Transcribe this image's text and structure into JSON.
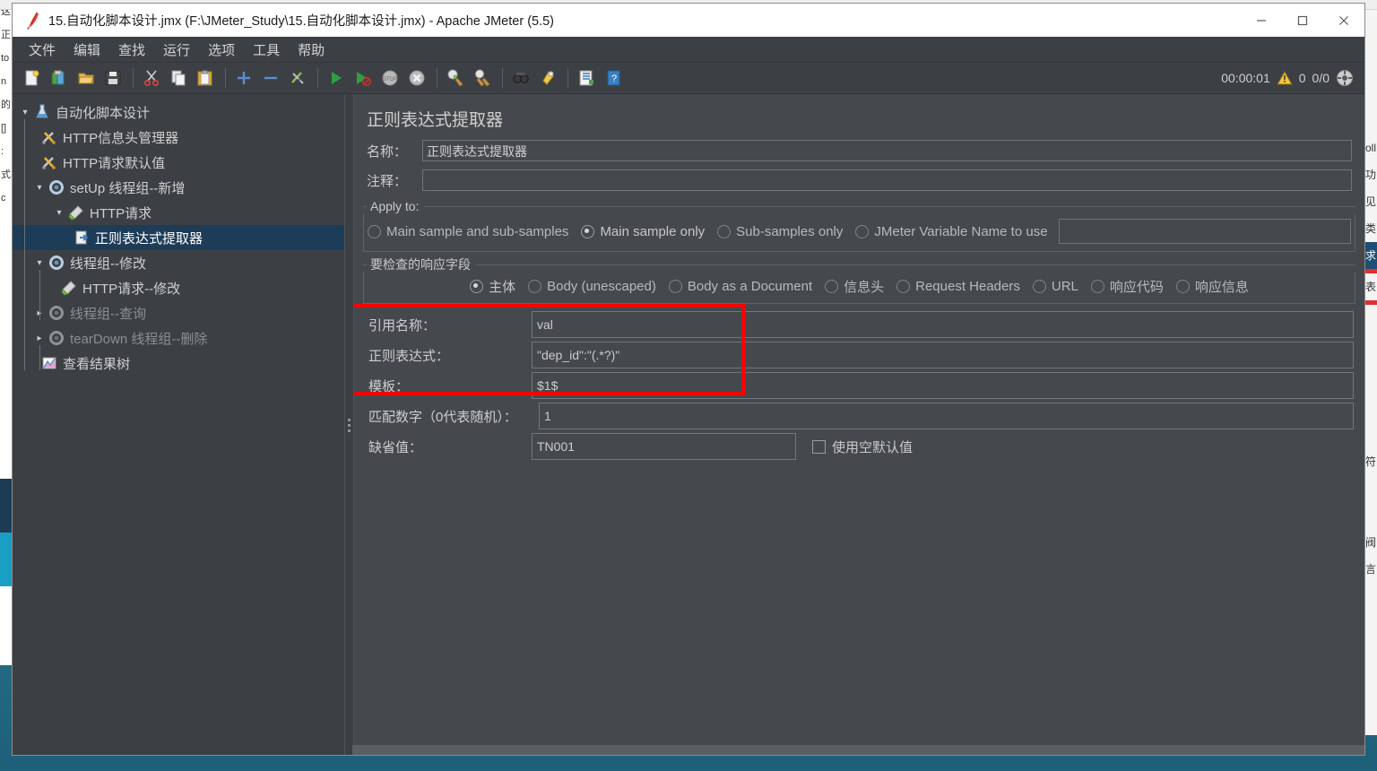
{
  "window": {
    "title": "15.自动化脚本设计.jmx (F:\\JMeter_Study\\15.自动化脚本设计.jmx) - Apache JMeter (5.5)",
    "minimize_label": "—",
    "maximize_label": "□",
    "close_label": "✕",
    "app_icon": "jmeter-feather-icon"
  },
  "menubar": {
    "items": [
      {
        "label": "文件"
      },
      {
        "label": "编辑"
      },
      {
        "label": "查找"
      },
      {
        "label": "运行"
      },
      {
        "label": "选项"
      },
      {
        "label": "工具"
      },
      {
        "label": "帮助"
      }
    ]
  },
  "toolbar": {
    "buttons": [
      {
        "name": "new-icon"
      },
      {
        "name": "templates-icon"
      },
      {
        "name": "open-icon"
      },
      {
        "name": "save-icon"
      },
      {
        "name": "cut-icon"
      },
      {
        "name": "copy-icon"
      },
      {
        "name": "paste-icon"
      },
      {
        "name": "expand-all-icon"
      },
      {
        "name": "collapse-all-icon"
      },
      {
        "name": "toggle-icon"
      },
      {
        "name": "start-icon"
      },
      {
        "name": "start-no-timers-icon"
      },
      {
        "name": "stop-icon"
      },
      {
        "name": "shutdown-icon"
      },
      {
        "name": "clear-icon"
      },
      {
        "name": "clear-all-icon"
      },
      {
        "name": "search-icon"
      },
      {
        "name": "reset-search-icon"
      },
      {
        "name": "function-helper-icon"
      },
      {
        "name": "help-icon"
      }
    ],
    "status": {
      "elapsed": "00:00:01",
      "warning_icon": "warning-triangle-icon",
      "warning_count": "0",
      "threads": "0/0",
      "connections_icon": "connections-icon"
    }
  },
  "tree": {
    "items": [
      {
        "label": "自动化脚本设计",
        "icon": "test-plan-icon",
        "twisty": "v",
        "indent": 0,
        "state": "normal"
      },
      {
        "label": "HTTP信息头管理器",
        "icon": "header-manager-icon",
        "twisty": "",
        "indent": 1,
        "state": "normal"
      },
      {
        "label": "HTTP请求默认值",
        "icon": "http-defaults-icon",
        "twisty": "",
        "indent": 1,
        "state": "normal"
      },
      {
        "label": "setUp 线程组--新增",
        "icon": "thread-group-icon",
        "twisty": "v",
        "indent": 1,
        "state": "normal"
      },
      {
        "label": "HTTP请求",
        "icon": "http-request-icon",
        "twisty": "v",
        "indent": 2,
        "state": "normal"
      },
      {
        "label": "正则表达式提取器",
        "icon": "post-processor-icon",
        "twisty": "",
        "indent": 3,
        "state": "selected"
      },
      {
        "label": "线程组--修改",
        "icon": "thread-group-icon",
        "twisty": "v",
        "indent": 1,
        "state": "normal"
      },
      {
        "label": "HTTP请求--修改",
        "icon": "http-request-icon",
        "twisty": "",
        "indent": 2,
        "state": "normal"
      },
      {
        "label": "线程组--查询",
        "icon": "thread-group-dim-icon",
        "twisty": ">",
        "indent": 1,
        "state": "disabled"
      },
      {
        "label": "tearDown 线程组--删除",
        "icon": "thread-group-dim-icon",
        "twisty": ">",
        "indent": 1,
        "state": "disabled"
      },
      {
        "label": "查看结果树",
        "icon": "view-results-tree-icon",
        "twisty": "",
        "indent": 1,
        "state": "normal"
      }
    ]
  },
  "panel": {
    "title": "正则表达式提取器",
    "name_label": "名称：",
    "name_value": "正则表达式提取器",
    "comment_label": "注释：",
    "comment_value": "",
    "apply_to": {
      "caption": "Apply to:",
      "options": [
        {
          "label": "Main sample and sub-samples",
          "selected": false
        },
        {
          "label": "Main sample only",
          "selected": true
        },
        {
          "label": "Sub-samples only",
          "selected": false
        },
        {
          "label": "JMeter Variable Name to use",
          "selected": false
        }
      ],
      "variable_value": ""
    },
    "response_field": {
      "caption": "要检查的响应字段",
      "options": [
        {
          "label": "主体",
          "selected": true
        },
        {
          "label": "Body (unescaped)",
          "selected": false
        },
        {
          "label": "Body as a Document",
          "selected": false
        },
        {
          "label": "信息头",
          "selected": false
        },
        {
          "label": "Request Headers",
          "selected": false
        },
        {
          "label": "URL",
          "selected": false
        },
        {
          "label": "响应代码",
          "selected": false
        },
        {
          "label": "响应信息",
          "selected": false
        }
      ]
    },
    "fields": [
      {
        "label": "引用名称：",
        "value": "val"
      },
      {
        "label": "正则表达式：",
        "value": "\"dep_id\":\"(.*?)\""
      },
      {
        "label": "模板：",
        "value": "$1$"
      },
      {
        "label": "匹配数字（0代表随机）：",
        "value": "1"
      },
      {
        "label": "缺省值：",
        "value": "TN001"
      }
    ],
    "empty_default_checkbox": {
      "label": "使用空默认值",
      "checked": false
    }
  },
  "annotation": {
    "highlight_color": "#ff0000",
    "highlight_note": "red-rectangle around 引用名称 / 正则表达式 / 模板"
  },
  "colors": {
    "window_bg": "#3c4044",
    "panel_bg": "#45494d",
    "selection": "#1d3c58",
    "text": "#cfcfcf",
    "desktop": "#2e7f99"
  },
  "background_windows": {
    "left_sliver_lines": [
      "这",
      "正",
      "to",
      "n",
      "的",
      "[]",
      ":",
      "式",
      "c"
    ],
    "right_sliver_lines": [
      "oll",
      "功",
      "见",
      "类",
      "求",
      "表",
      "符",
      "阀",
      "言"
    ]
  }
}
